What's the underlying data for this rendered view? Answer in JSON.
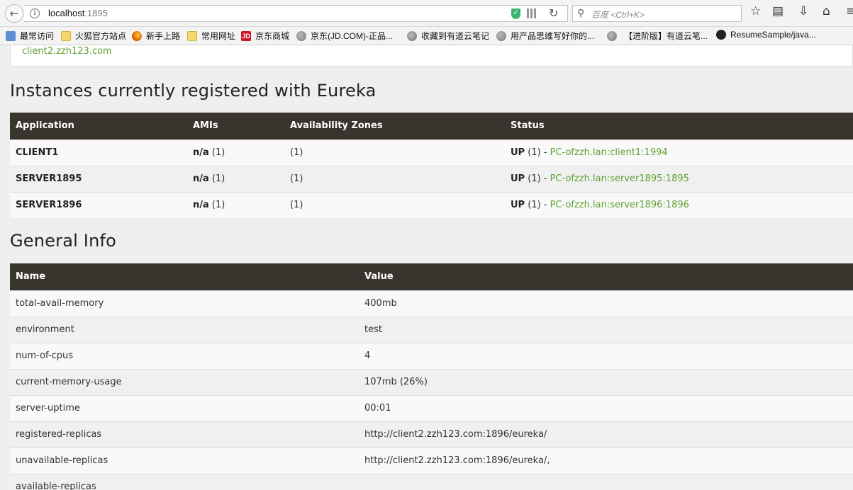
{
  "browser": {
    "url_host": "localhost",
    "url_port": ":1895",
    "search_placeholder": "百度 <Ctrl+K>"
  },
  "bookmarks": [
    {
      "label": "最常访问",
      "icon": "most-visited-icon"
    },
    {
      "label": "火狐官方站点",
      "icon": "folder-icon"
    },
    {
      "label": "新手上路",
      "icon": "firefox-icon"
    },
    {
      "label": "常用网址",
      "icon": "folder-icon"
    },
    {
      "label": "京东商城",
      "icon": "jd-icon"
    },
    {
      "label": "京东(JD.COM)-正品...",
      "icon": "globe-icon"
    },
    {
      "label": "收藏到有道云笔记",
      "icon": "globe-icon"
    },
    {
      "label": "用产品思维写好你的...",
      "icon": "globe-icon"
    },
    {
      "label": "【进阶版】有道云笔...",
      "icon": "globe-icon"
    },
    {
      "label": "ResumeSample/java...",
      "icon": "github-icon"
    }
  ],
  "top_panel": {
    "link": "client2.zzh123.com"
  },
  "instances": {
    "heading": "Instances currently registered with Eureka",
    "headers": [
      "Application",
      "AMIs",
      "Availability Zones",
      "Status"
    ],
    "rows": [
      {
        "app": "CLIENT1",
        "amis_bold": "n/a",
        "amis_count": " (1)",
        "zones": "(1)",
        "status_bold": "UP",
        "status_count": " (1) - ",
        "status_link": "PC-ofzzh.lan:client1:1994"
      },
      {
        "app": "SERVER1895",
        "amis_bold": "n/a",
        "amis_count": " (1)",
        "zones": "(1)",
        "status_bold": "UP",
        "status_count": " (1) - ",
        "status_link": "PC-ofzzh.lan:server1895:1895"
      },
      {
        "app": "SERVER1896",
        "amis_bold": "n/a",
        "amis_count": " (1)",
        "zones": "(1)",
        "status_bold": "UP",
        "status_count": " (1) - ",
        "status_link": "PC-ofzzh.lan:server1896:1896"
      }
    ]
  },
  "general": {
    "heading": "General Info",
    "headers": [
      "Name",
      "Value"
    ],
    "rows": [
      {
        "name": "total-avail-memory",
        "value": "400mb"
      },
      {
        "name": "environment",
        "value": "test"
      },
      {
        "name": "num-of-cpus",
        "value": "4"
      },
      {
        "name": "current-memory-usage",
        "value": "107mb (26%)"
      },
      {
        "name": "server-uptime",
        "value": "00:01"
      },
      {
        "name": "registered-replicas",
        "value": "http://client2.zzh123.com:1896/eureka/"
      },
      {
        "name": "unavailable-replicas",
        "value": "http://client2.zzh123.com:1896/eureka/,"
      },
      {
        "name": "available-replicas",
        "value": ""
      }
    ]
  },
  "colors": {
    "link_green": "#5fa134",
    "table_header_bg": "#3a342e"
  }
}
